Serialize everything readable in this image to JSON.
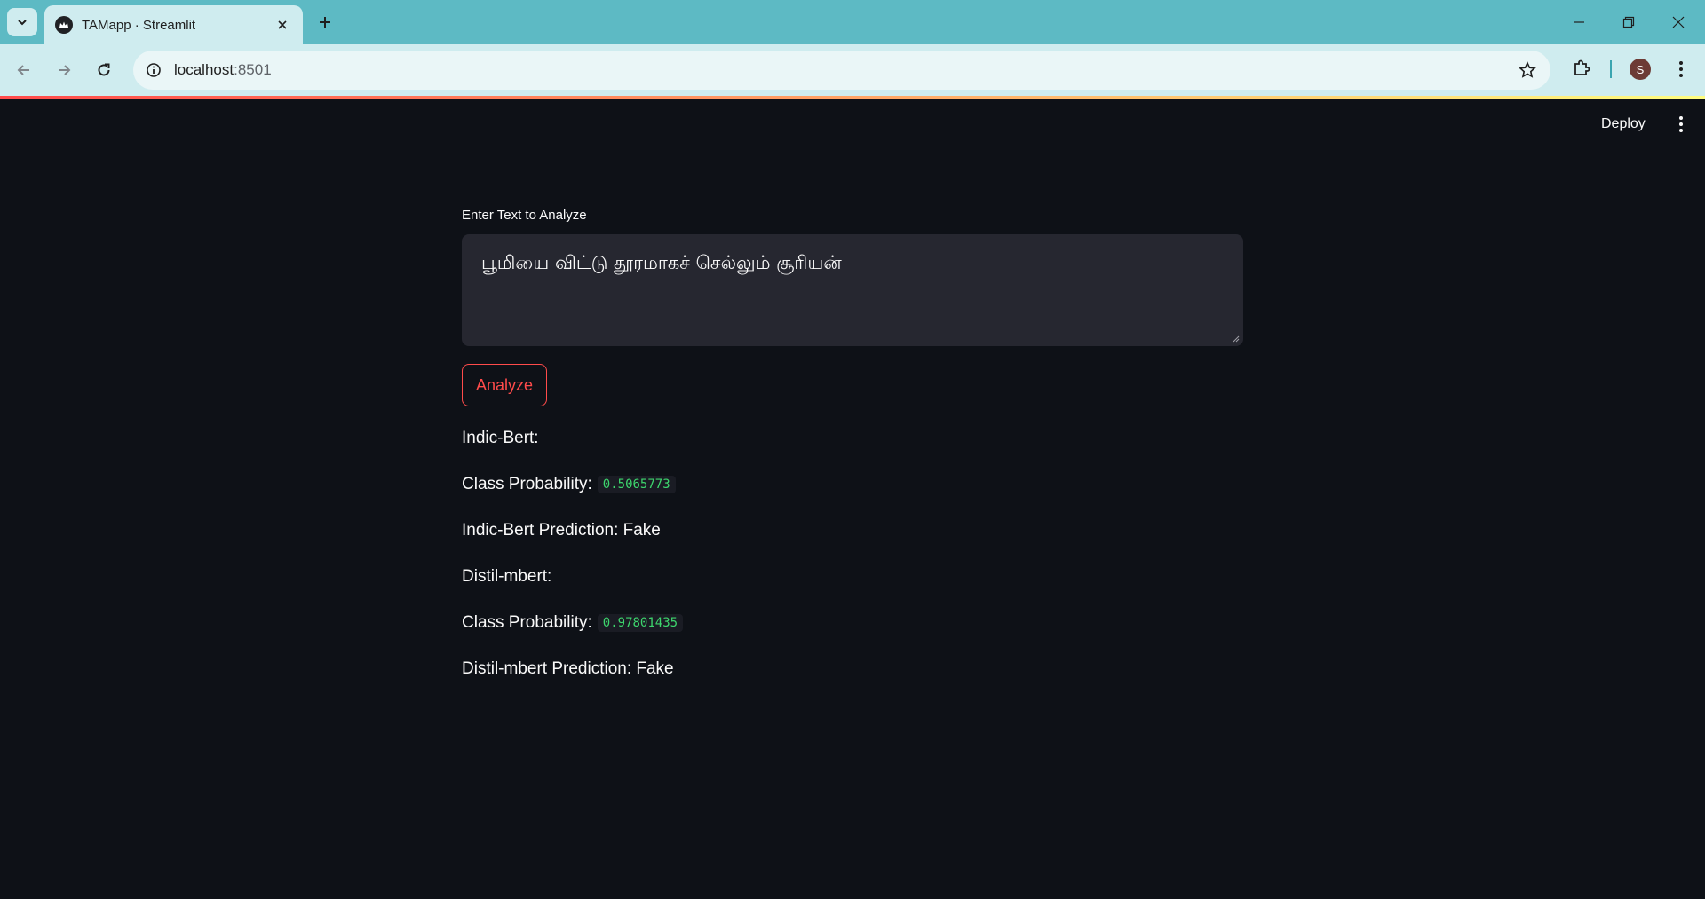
{
  "browser": {
    "tab_title": "TAMapp · Streamlit",
    "url_host": "localhost",
    "url_port": ":8501",
    "profile_initial": "S"
  },
  "app": {
    "deploy_label": "Deploy",
    "input_label": "Enter Text to Analyze",
    "input_value": "பூமியை விட்டு தூரமாகச் செல்லும் சூரியன்",
    "analyze_label": "Analyze"
  },
  "results": {
    "model1_heading": "Indic-Bert:",
    "model1_prob_label": "Class Probability:",
    "model1_prob_value": "0.5065773",
    "model1_prediction": "Indic-Bert Prediction: Fake",
    "model2_heading": "Distil-mbert:",
    "model2_prob_label": "Class Probability:",
    "model2_prob_value": "0.97801435",
    "model2_prediction": "Distil-mbert Prediction: Fake"
  },
  "colors": {
    "tabbar": "#5dbac4",
    "toolbar": "#cfecef",
    "app_bg": "#0e1117",
    "accent": "#ff4b4b",
    "code_green": "#3dd56d"
  }
}
